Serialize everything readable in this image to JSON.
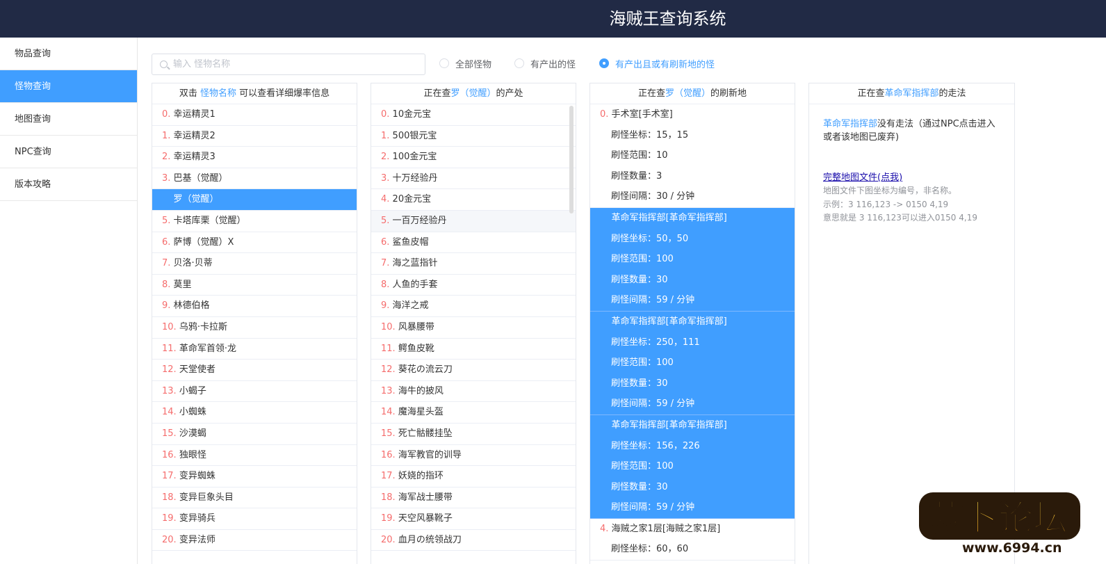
{
  "header": {
    "title": "海贼王查询系统"
  },
  "sidebar": {
    "items": [
      {
        "label": "物品查询",
        "active": false
      },
      {
        "label": "怪物查询",
        "active": true
      },
      {
        "label": "地图查询",
        "active": false
      },
      {
        "label": "NPC查询",
        "active": false
      },
      {
        "label": "版本攻略",
        "active": false
      }
    ]
  },
  "search": {
    "placeholder": "输入 怪物名称",
    "value": ""
  },
  "filters": [
    {
      "label": "全部怪物",
      "checked": false
    },
    {
      "label": "有产出的怪",
      "checked": false
    },
    {
      "label": "有产出且或有刷新地的怪",
      "checked": true
    }
  ],
  "monster_panel": {
    "head_pre": "双击 ",
    "head_hl": "怪物名称",
    "head_post": " 可以查看详细爆率信息",
    "items": [
      {
        "idx": "0.",
        "name": "幸运精灵1"
      },
      {
        "idx": "1.",
        "name": "幸运精灵2"
      },
      {
        "idx": "2.",
        "name": "幸运精灵3"
      },
      {
        "idx": "3.",
        "name": "巴基（觉醒）"
      },
      {
        "idx": "4.",
        "name": "罗（觉醒）"
      },
      {
        "idx": "5.",
        "name": "卡塔库栗（觉醒）"
      },
      {
        "idx": "6.",
        "name": "萨博（觉醒）X"
      },
      {
        "idx": "7.",
        "name": "贝洛·贝蒂"
      },
      {
        "idx": "8.",
        "name": "莫里"
      },
      {
        "idx": "9.",
        "name": "林德伯格"
      },
      {
        "idx": "10.",
        "name": "乌鸦·卡拉斯"
      },
      {
        "idx": "11.",
        "name": "革命军首领·龙"
      },
      {
        "idx": "12.",
        "name": "天堂使者"
      },
      {
        "idx": "13.",
        "name": "小蝎子"
      },
      {
        "idx": "14.",
        "name": "小蜘蛛"
      },
      {
        "idx": "15.",
        "name": "沙漠蝎"
      },
      {
        "idx": "16.",
        "name": "独眼怪"
      },
      {
        "idx": "17.",
        "name": "变异蜘蛛"
      },
      {
        "idx": "18.",
        "name": "变异巨象头目"
      },
      {
        "idx": "19.",
        "name": "变异骑兵"
      },
      {
        "idx": "20.",
        "name": "变异法师"
      }
    ],
    "selected_index": 4
  },
  "drops_panel": {
    "head_pre": "正在查",
    "head_hl": "罗（觉醒）",
    "head_post": "的产处",
    "items": [
      {
        "idx": "0.",
        "name": "10金元宝"
      },
      {
        "idx": "1.",
        "name": "500银元宝"
      },
      {
        "idx": "2.",
        "name": "100金元宝"
      },
      {
        "idx": "3.",
        "name": "十万经验丹"
      },
      {
        "idx": "4.",
        "name": "20金元宝"
      },
      {
        "idx": "5.",
        "name": "一百万经验丹"
      },
      {
        "idx": "6.",
        "name": "鲨鱼皮帽"
      },
      {
        "idx": "7.",
        "name": "海之蓝指针"
      },
      {
        "idx": "8.",
        "name": "人鱼的手套"
      },
      {
        "idx": "9.",
        "name": "海洋之戒"
      },
      {
        "idx": "10.",
        "name": "风暴腰带"
      },
      {
        "idx": "11.",
        "name": "鳄鱼皮靴"
      },
      {
        "idx": "12.",
        "name": "葵花の流云刀"
      },
      {
        "idx": "13.",
        "name": "海牛的披风"
      },
      {
        "idx": "14.",
        "name": "魔海星头盔"
      },
      {
        "idx": "15.",
        "name": "死亡骷髅挂坠"
      },
      {
        "idx": "16.",
        "name": "海军教官的训导"
      },
      {
        "idx": "17.",
        "name": "妖娆的指环"
      },
      {
        "idx": "18.",
        "name": "海军战士腰带"
      },
      {
        "idx": "19.",
        "name": "天空风暴靴子"
      },
      {
        "idx": "20.",
        "name": "血月の统领战刀"
      }
    ],
    "hover_index": 5
  },
  "spawn_panel": {
    "head_pre": "正在查",
    "head_hl": "罗（觉醒）",
    "head_post": "的刷新地",
    "groups": [
      {
        "idx": "0.",
        "title": "手术室[手术室]",
        "selected": false,
        "attrs": [
          "刷怪坐标：15，15",
          "刷怪范围：10",
          "刷怪数量：3",
          "刷怪间隔：30 / 分钟"
        ]
      },
      {
        "idx": "1.",
        "title": "革命军指挥部[革命军指挥部]",
        "selected": true,
        "attrs": [
          "刷怪坐标：50，50",
          "刷怪范围：100",
          "刷怪数量：30",
          "刷怪间隔：59 / 分钟"
        ]
      },
      {
        "idx": "2.",
        "title": "革命军指挥部[革命军指挥部]",
        "selected": true,
        "attrs": [
          "刷怪坐标：250，111",
          "刷怪范围：100",
          "刷怪数量：30",
          "刷怪间隔：59 / 分钟"
        ]
      },
      {
        "idx": "3.",
        "title": "革命军指挥部[革命军指挥部]",
        "selected": true,
        "attrs": [
          "刷怪坐标：156，226",
          "刷怪范围：100",
          "刷怪数量：30",
          "刷怪间隔：59 / 分钟"
        ]
      },
      {
        "idx": "4.",
        "title": "海贼之家1层[海贼之家1层]",
        "selected": false,
        "attrs": [
          "刷怪坐标：60，60"
        ]
      }
    ]
  },
  "route_panel": {
    "head_pre": "正在查",
    "head_hl": "革命军指挥部",
    "head_post": "的走法",
    "msg_hl": "革命军指挥部",
    "msg_rest": "没有走法（通过NPC点击进入或者该地图已废弃)",
    "link": "完整地图文件(点我)",
    "notes": [
      "地图文件下图坐标为编号，非名称。",
      "示例：3 116,123 -> 0150 4,19",
      "意思就是 3 116,123可以进入0150 4,19"
    ]
  },
  "watermark": {
    "brand": "萝卜论坛",
    "url": "www.6994.cn"
  },
  "colors": {
    "header_bg": "#212a45",
    "accent": "#409eff",
    "index_red": "#f56c6c"
  }
}
